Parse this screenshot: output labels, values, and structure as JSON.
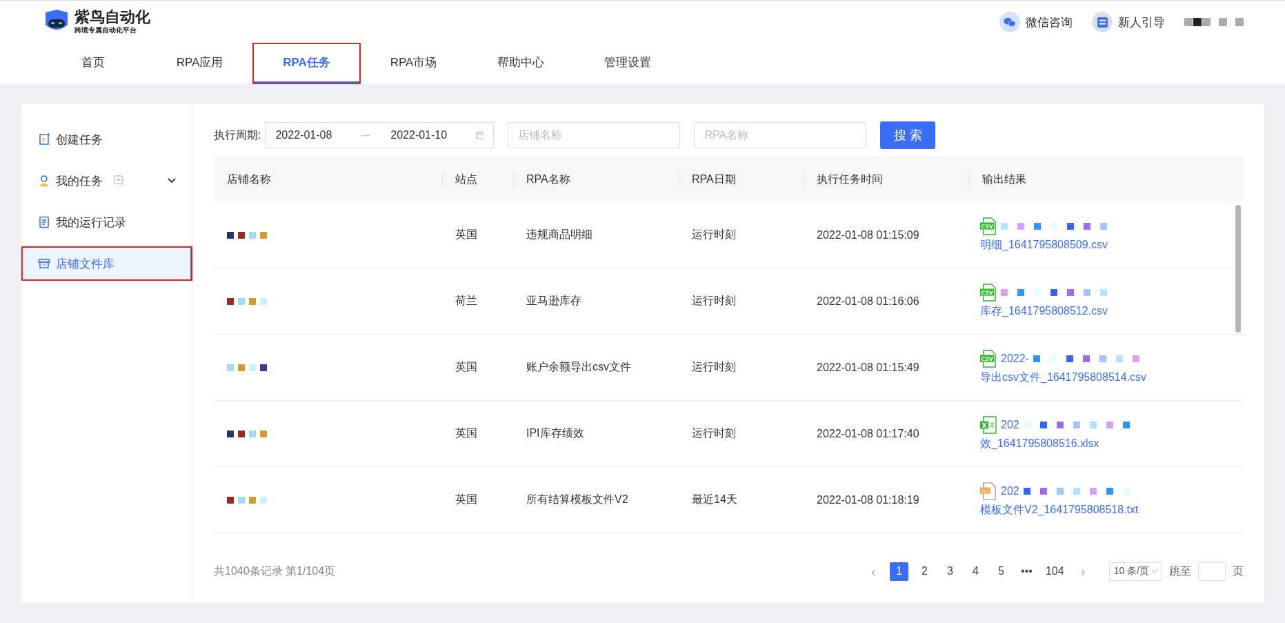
{
  "header": {
    "logo_title": "紫鸟自动化",
    "logo_subtitle": "跨境专属自动化平台",
    "actions": [
      {
        "kind": "wechat",
        "label": "微信咨询"
      },
      {
        "kind": "guide",
        "label": "新人引导"
      }
    ],
    "user_redacted": true
  },
  "nav": [
    {
      "label": "首页",
      "selected": false,
      "highlighted": false
    },
    {
      "label": "RPA应用",
      "selected": false,
      "highlighted": false
    },
    {
      "label": "RPA任务",
      "selected": true,
      "highlighted": true
    },
    {
      "label": "RPA市场",
      "selected": false,
      "highlighted": false
    },
    {
      "label": "帮助中心",
      "selected": false,
      "highlighted": false
    },
    {
      "label": "管理设置",
      "selected": false,
      "highlighted": false
    }
  ],
  "sidebar": {
    "items": [
      {
        "kind": "create",
        "label": "创建任务",
        "selected": false,
        "highlighted": false,
        "expandable": false
      },
      {
        "kind": "mine",
        "label": "我的任务",
        "selected": false,
        "highlighted": false,
        "expandable": true
      },
      {
        "kind": "log",
        "label": "我的运行记录",
        "selected": false,
        "highlighted": false,
        "expandable": false
      },
      {
        "kind": "store",
        "label": "店铺文件库",
        "selected": true,
        "highlighted": true,
        "expandable": false
      }
    ]
  },
  "filters": {
    "period_label": "执行周期:",
    "date_start": "2022-01-08",
    "date_end": "2022-01-10",
    "store_placeholder": "店铺名称",
    "rpa_placeholder": "RPA名称",
    "search_button": "搜 索"
  },
  "table": {
    "columns": [
      "店铺名称",
      "站点",
      "RPA名称",
      "RPA日期",
      "执行任务时间",
      "输出结果"
    ],
    "rows": [
      {
        "station": "英国",
        "rpa": "违规商品明细",
        "rpa_date": "运行时刻",
        "time": "2022-01-08 01:15:09",
        "file": {
          "kind": "table",
          "icon_text": "CSV",
          "name": "明细_1641795808509.csv"
        }
      },
      {
        "station": "荷兰",
        "rpa": "亚马逊库存",
        "rpa_date": "运行时刻",
        "time": "2022-01-08 01:16:06",
        "file": {
          "kind": "table",
          "icon_text": "CSV",
          "name": "库存_1641795808512.csv"
        }
      },
      {
        "station": "英国",
        "rpa": "账户余额导出csv文件",
        "rpa_date": "运行时刻",
        "time": "2022-01-08 01:15:49",
        "file": {
          "kind": "table",
          "icon_text": "CSV",
          "prefix": "2022-",
          "name": "导出csv文件_1641795808514.csv"
        }
      },
      {
        "station": "英国",
        "rpa": "IPI库存绩效",
        "rpa_date": "运行时刻",
        "time": "2022-01-08 01:17:40",
        "file": {
          "kind": "excel",
          "icon_text": "X",
          "prefix": "202",
          "name": "效_1641795808516.xlsx"
        }
      },
      {
        "station": "英国",
        "rpa": "所有结算模板文件V2",
        "rpa_date": "最近14天",
        "time": "2022-01-08 01:18:19",
        "file": {
          "kind": "text",
          "icon_text": "txt",
          "prefix": "202",
          "name": "模板文件V2_1641795808518.txt"
        }
      }
    ]
  },
  "pagination": {
    "summary": "共1040条记录 第1/104页",
    "prev": "‹",
    "next": "›",
    "pages": [
      {
        "label": "1",
        "selected": true
      },
      {
        "label": "2",
        "selected": false
      },
      {
        "label": "3",
        "selected": false
      },
      {
        "label": "4",
        "selected": false
      },
      {
        "label": "5",
        "selected": false
      },
      {
        "label": "•••",
        "selected": false
      },
      {
        "label": "104",
        "selected": false
      }
    ],
    "page_size": "10 条/页",
    "jump_label": "跳至",
    "page_unit": "页"
  }
}
